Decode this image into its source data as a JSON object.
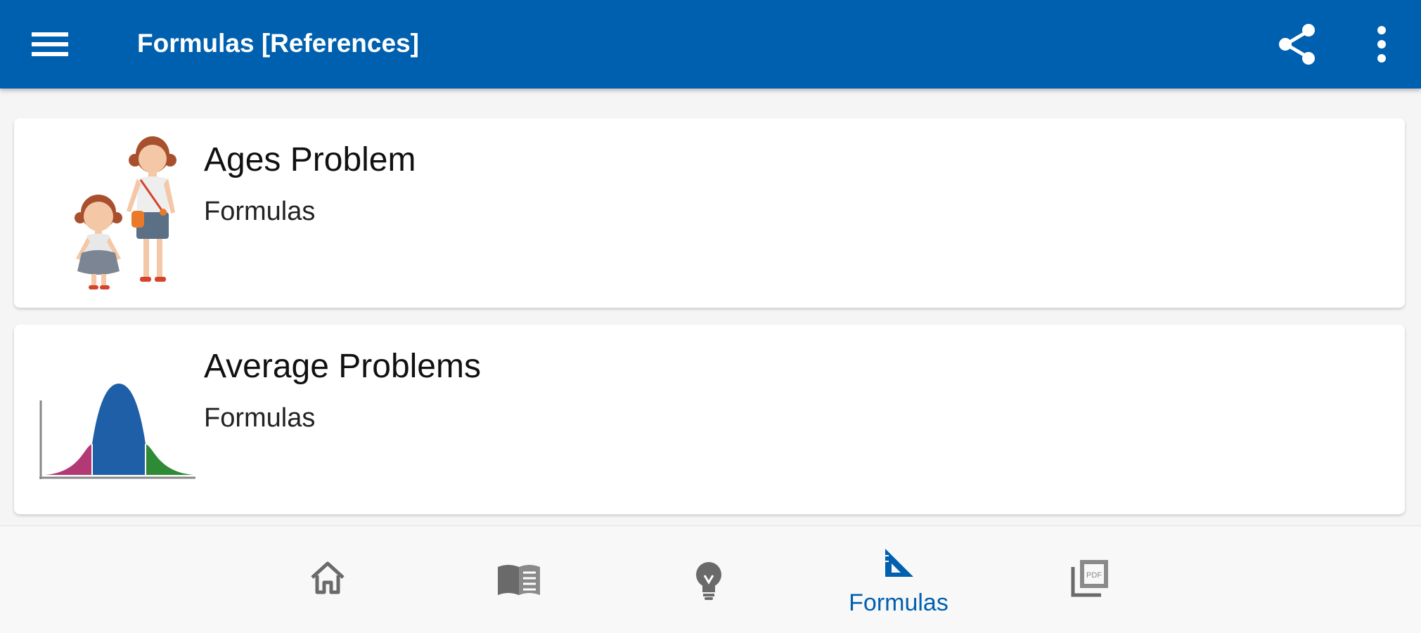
{
  "appbar": {
    "title": "Formulas [References]",
    "background_color": "#0060b0",
    "menu_icon": "hamburger-menu-icon",
    "share_icon": "share-icon",
    "more_icon": "more-vert-icon"
  },
  "cards": [
    {
      "title": "Ages Problem",
      "subtitle": "Formulas",
      "thumbnail": "two-girls-illustration"
    },
    {
      "title": "Average Problems",
      "subtitle": "Formulas",
      "thumbnail": "bell-curve-chart"
    }
  ],
  "bottom_nav": {
    "items": [
      {
        "icon": "home-icon",
        "label": "",
        "active": false
      },
      {
        "icon": "book-icon",
        "label": "",
        "active": false
      },
      {
        "icon": "lightbulb-icon",
        "label": "",
        "active": false
      },
      {
        "icon": "triangle-ruler-icon",
        "label": "Formulas",
        "active": true
      },
      {
        "icon": "pdf-icon",
        "label": "",
        "active": false
      }
    ],
    "active_color": "#0060b0",
    "inactive_color": "#6a6a6a"
  }
}
